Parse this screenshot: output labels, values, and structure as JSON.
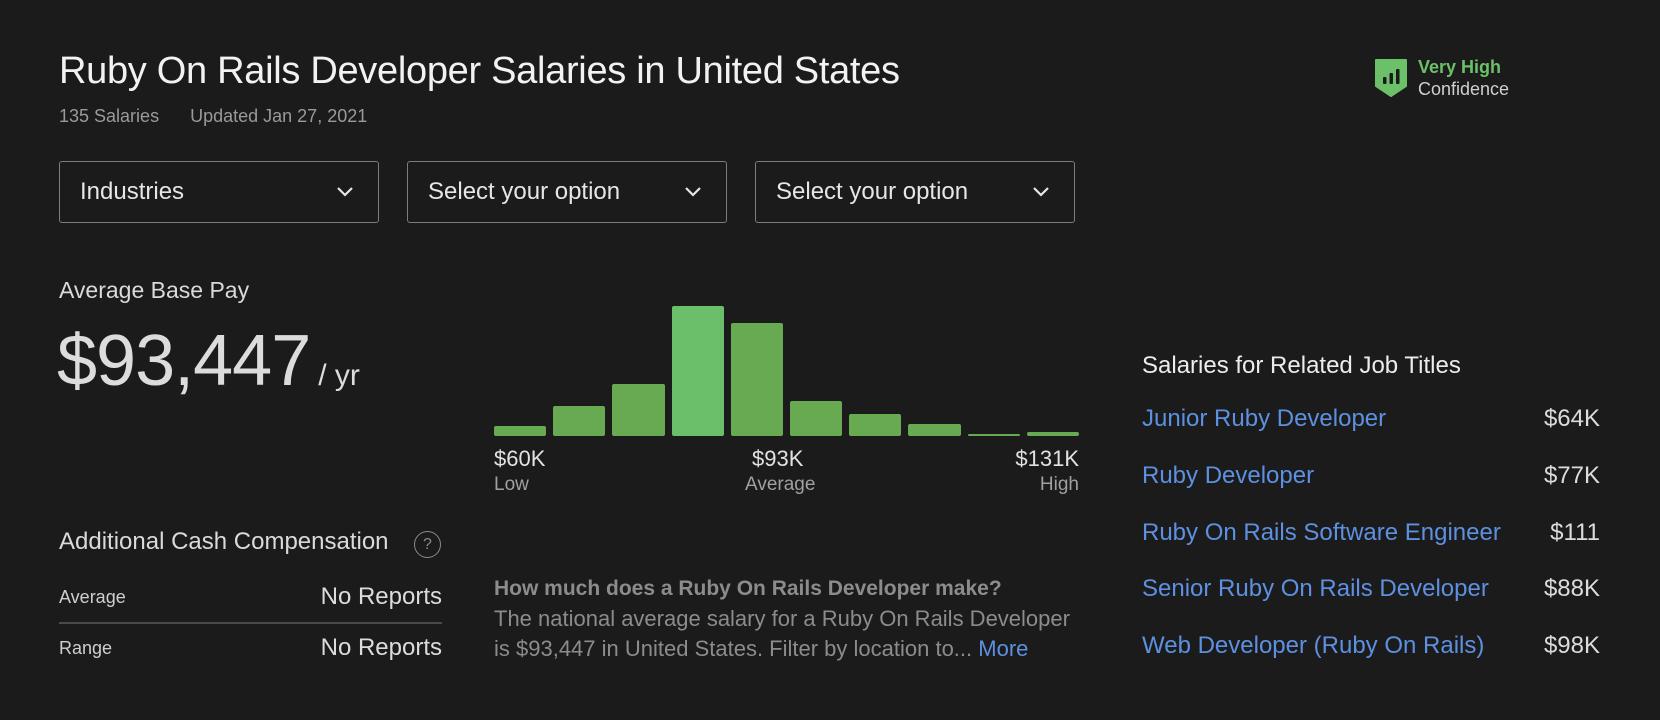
{
  "header": {
    "title": "Ruby On Rails Developer Salaries in United States",
    "salary_count": "135 Salaries",
    "updated": "Updated Jan 27, 2021"
  },
  "confidence": {
    "level": "Very High",
    "label": "Confidence",
    "icon": "bar-chart-shield-icon",
    "color": "#6cc06a"
  },
  "filters": [
    {
      "value": "Industries",
      "icon": "chevron-down-icon"
    },
    {
      "value": "Select your option",
      "icon": "chevron-down-icon"
    },
    {
      "value": "Select your option",
      "icon": "chevron-down-icon"
    }
  ],
  "average_base_pay": {
    "label": "Average Base Pay",
    "amount": "$93,447",
    "unit": "/ yr"
  },
  "chart_data": {
    "type": "bar",
    "title": "",
    "xlabel": "",
    "ylabel": "",
    "categories": [
      "bin1",
      "bin2",
      "bin3",
      "bin4",
      "bin5",
      "bin6",
      "bin7",
      "bin8",
      "bin9",
      "bin10"
    ],
    "values": [
      8,
      23,
      40,
      100,
      87,
      27,
      17,
      9,
      1,
      3
    ],
    "highlight_index": 3,
    "ylim": [
      0,
      100
    ],
    "colors": {
      "bar": "#68aa52",
      "highlight": "#6bbf6b"
    },
    "axis_labels": [
      {
        "value": "$60K",
        "sub": "Low"
      },
      {
        "value": "$93K",
        "sub": "Average"
      },
      {
        "value": "$131K",
        "sub": "High"
      }
    ]
  },
  "additional_cash": {
    "title": "Additional Cash Compensation",
    "help_icon": "question-circle-icon",
    "rows": [
      {
        "label": "Average",
        "value": "No Reports"
      },
      {
        "label": "Range",
        "value": "No Reports"
      }
    ]
  },
  "faq": {
    "question": "How much does a Ruby On Rails Developer make?",
    "answer": "The national average salary for a Ruby On Rails Developer is $93,447 in United States. Filter by location to...",
    "more_label": "More"
  },
  "related": {
    "title": "Salaries for Related Job Titles",
    "items": [
      {
        "title": "Junior Ruby Developer",
        "salary": "$64K"
      },
      {
        "title": "Ruby Developer",
        "salary": "$77K"
      },
      {
        "title": "Ruby On Rails Software Engineer",
        "salary": "$111"
      },
      {
        "title": "Senior Ruby On Rails Developer",
        "salary": "$88K"
      },
      {
        "title": "Web Developer (Ruby On Rails)",
        "salary": "$98K"
      }
    ]
  },
  "theme": {
    "link": "#5d90e0",
    "background": "#1b1b1b"
  }
}
